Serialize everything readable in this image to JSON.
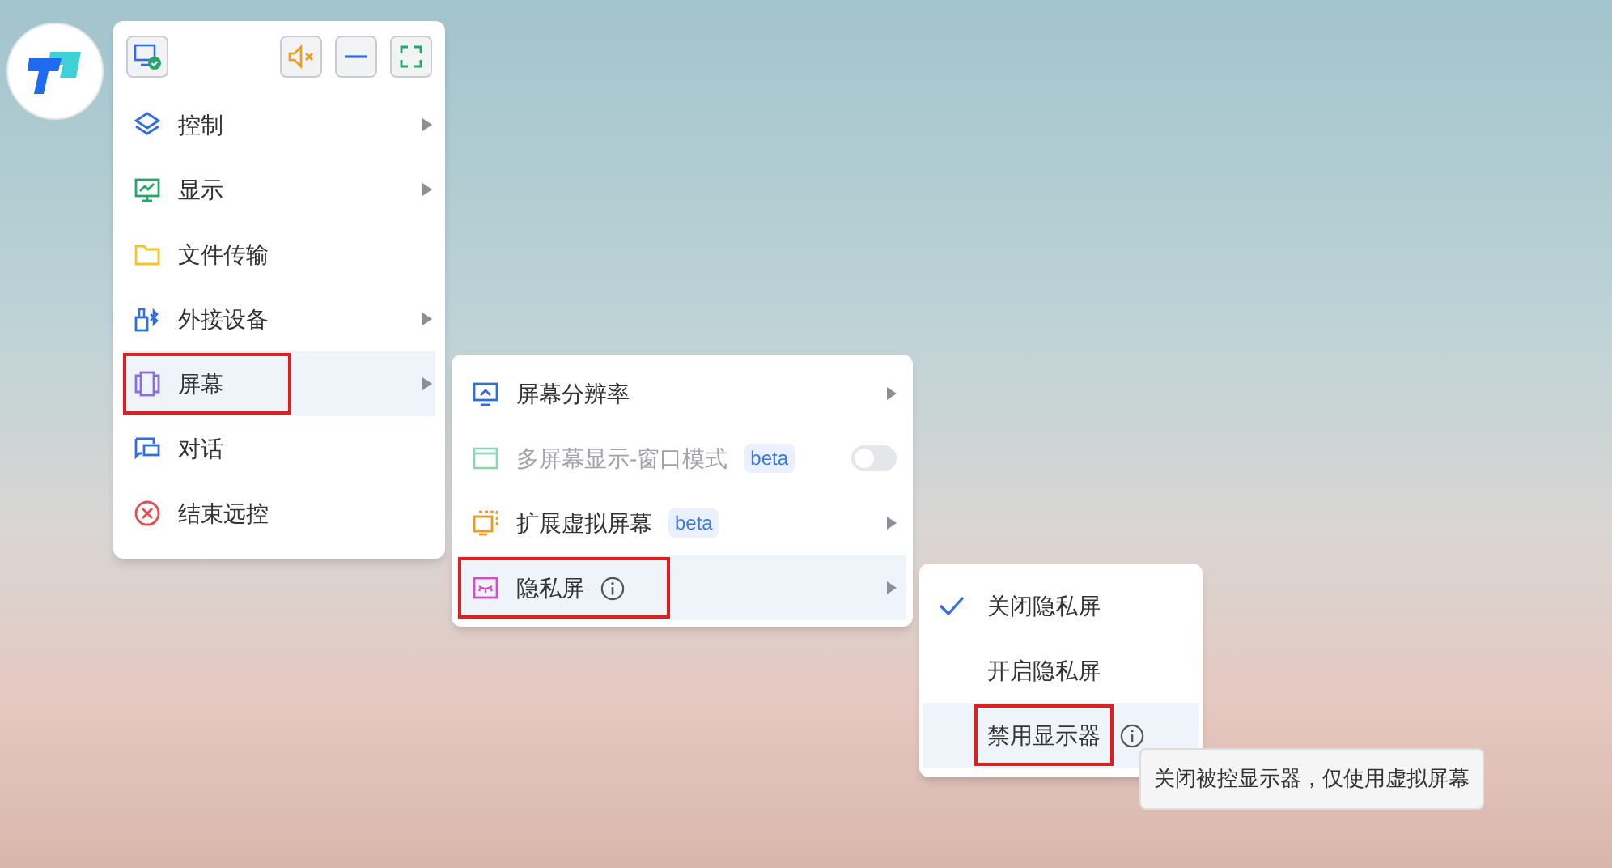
{
  "toolbar": [
    {
      "kind": "monitor"
    },
    {
      "kind": "mute"
    },
    {
      "kind": "minimize"
    },
    {
      "kind": "fullscreen"
    }
  ],
  "menu": {
    "items": [
      {
        "label": "控制",
        "submenu": true,
        "selected": false,
        "highlighted": false
      },
      {
        "label": "显示",
        "submenu": true,
        "selected": false,
        "highlighted": false
      },
      {
        "label": "文件传输",
        "submenu": false,
        "selected": false,
        "highlighted": false
      },
      {
        "label": "外接设备",
        "submenu": true,
        "selected": false,
        "highlighted": false
      },
      {
        "label": "屏幕",
        "submenu": true,
        "selected": true,
        "highlighted": true
      },
      {
        "label": "对话",
        "submenu": false,
        "selected": false,
        "highlighted": false
      },
      {
        "label": "结束远控",
        "submenu": false,
        "selected": false,
        "highlighted": false
      }
    ]
  },
  "screen_menu": {
    "items": [
      {
        "label": "屏幕分辨率",
        "kind": "submenu",
        "info": false,
        "disabled": false,
        "selected": false,
        "highlighted": false
      },
      {
        "label": "多屏幕显示-窗口模式",
        "kind": "toggle",
        "badge": "beta",
        "on": false,
        "info": false,
        "disabled": true,
        "selected": false,
        "highlighted": false
      },
      {
        "label": "扩展虚拟屏幕",
        "kind": "submenu",
        "badge": "beta",
        "info": false,
        "disabled": false,
        "selected": false,
        "highlighted": false
      },
      {
        "label": "隐私屏",
        "kind": "submenu",
        "info": true,
        "disabled": false,
        "selected": true,
        "highlighted": true
      }
    ]
  },
  "privacy_menu": {
    "items": [
      {
        "label": "关闭隐私屏",
        "checked": true,
        "info": false,
        "selected": false,
        "highlighted": false
      },
      {
        "label": "开启隐私屏",
        "checked": false,
        "info": false,
        "selected": false,
        "highlighted": false
      },
      {
        "label": "禁用显示器",
        "checked": false,
        "info": true,
        "selected": true,
        "highlighted": true
      }
    ]
  },
  "tooltip": "关闭被控显示器，仅使用虚拟屏幕"
}
